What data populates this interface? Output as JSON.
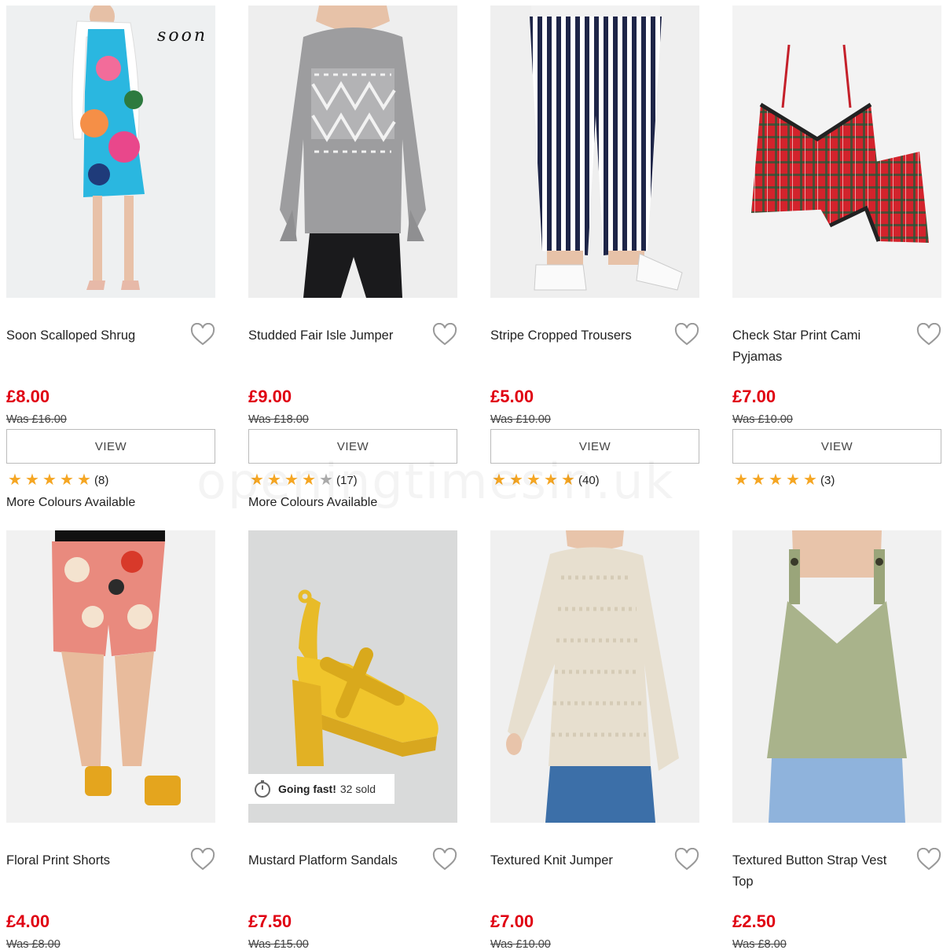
{
  "watermark": "openingtimesin.uk",
  "common": {
    "view_label": "VIEW"
  },
  "products": [
    {
      "name": "Soon Scalloped Shrug",
      "price": "£8.00",
      "was": "Was £16.00",
      "rating_count": "(8)",
      "stars": 5,
      "colours": "More Colours Available",
      "image_tag": "soon"
    },
    {
      "name": "Studded Fair Isle Jumper",
      "price": "£9.00",
      "was": "Was £18.00",
      "rating_count": "(17)",
      "stars": 4,
      "colours": "More Colours Available"
    },
    {
      "name": "Stripe Cropped Trousers",
      "price": "£5.00",
      "was": "Was £10.00",
      "rating_count": "(40)",
      "stars": 5
    },
    {
      "name": "Check Star Print Cami Pyjamas",
      "price": "£7.00",
      "was": "Was £10.00",
      "rating_count": "(3)",
      "stars": 5
    },
    {
      "name": "Floral Print Shorts",
      "price": "£4.00",
      "was": "Was £8.00"
    },
    {
      "name": "Mustard Platform Sandals",
      "price": "£7.50",
      "was": "Was £15.00",
      "badge": {
        "bold": "Going fast!",
        "text": "32 sold"
      }
    },
    {
      "name": "Textured Knit Jumper",
      "price": "£7.00",
      "was": "Was £10.00"
    },
    {
      "name": "Textured Button Strap Vest Top",
      "price": "£2.50",
      "was": "Was £8.00"
    }
  ],
  "colors": {
    "price_red": "#e00012",
    "star_gold": "#f5a623"
  },
  "icons": {
    "wishlist": "heart-outline-icon",
    "star": "star-icon",
    "stopwatch": "stopwatch-icon"
  }
}
